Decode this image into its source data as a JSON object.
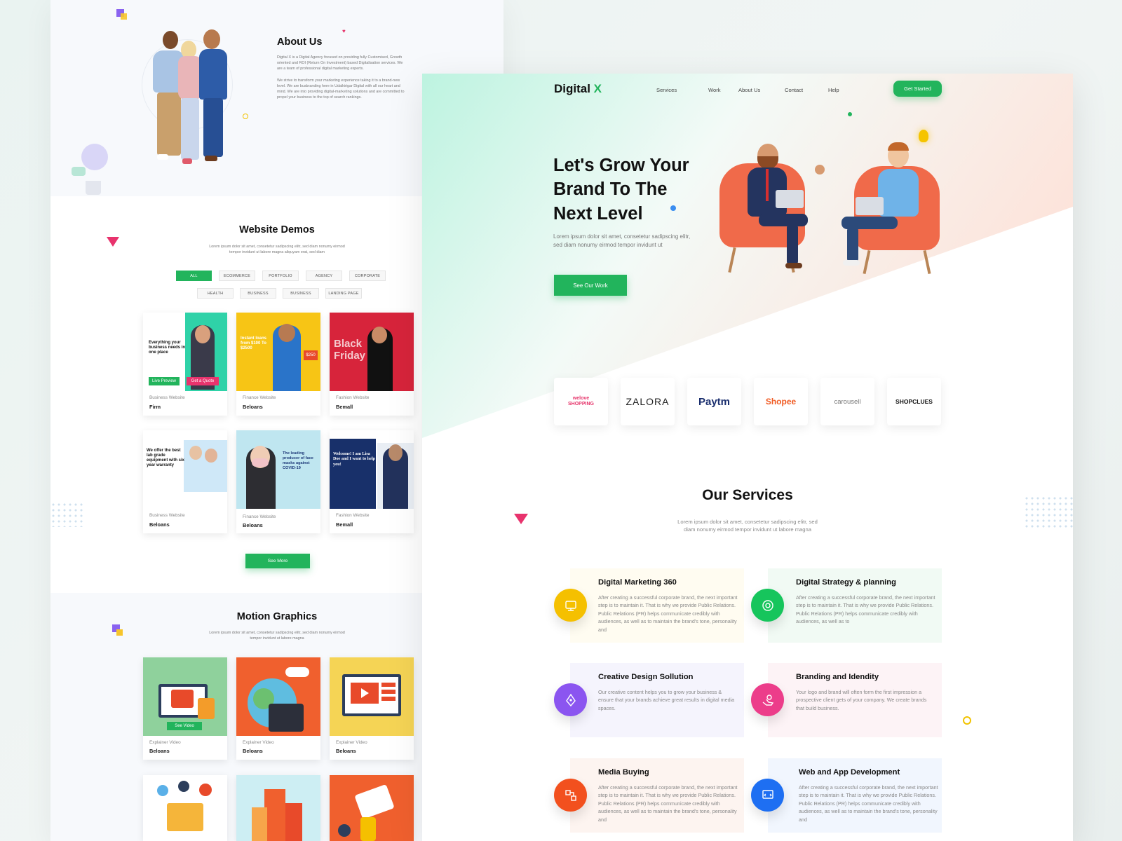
{
  "left": {
    "about": {
      "title": "About Us",
      "para1": "Digital X is a Digital Agency focused on providing fully Customised, Growth oriented and ROI (Return On Investment) based Digitalisation services. We are a team of professional digital marketing experts.",
      "para2": "We strive to transform your marketing experience taking it to a brand-new level. We are busbranding here in Udaikirigar Digital with all our heart and mind. We are into providing digital-marketing solutions and are committed to propel your business to the top of search rankings."
    },
    "demos": {
      "title": "Website Demos",
      "subtitle": "Lorem ipsum dolor sit amet, consetetur sadipscing elitr, sed diam nonumy eirmod tempor invidunt ut labore magna aliquyam erat, sed diam",
      "filters_row1": [
        "ALL",
        "ECOMMERCE",
        "PORTFOLIO",
        "AGENCY",
        "CORPORATE"
      ],
      "filters_row2": [
        "HEALTH",
        "BUSINESS",
        "BUSINESS",
        "LANDING PAGE"
      ],
      "cards": [
        {
          "category": "Business Website",
          "name": "Firm",
          "thumb_headline": "Everything your business needs in one place",
          "btn1": "Live Preview",
          "btn2": "Get a Quote"
        },
        {
          "category": "Finance Website",
          "name": "Beloans",
          "thumb_headline": "Instant loans from $100 To $2500",
          "price": "$250"
        },
        {
          "category": "Fashion Website",
          "name": "Bemall",
          "thumb_headline": "Black Friday"
        },
        {
          "category": "Business Website",
          "name": "Beloans",
          "thumb_headline": "We offer the best lab grade equipment with six year warranty"
        },
        {
          "category": "Finance Website",
          "name": "Beloans",
          "thumb_headline": "The leading producer of face masks against COVID-19"
        },
        {
          "category": "Fashion Website",
          "name": "Bemall",
          "thumb_headline": "Welcome! I am Lisa Doe and I want to help you!"
        }
      ],
      "see_more": "See More"
    },
    "motion": {
      "title": "Motion Graphics",
      "subtitle": "Lorem ipsum dolor sit amet, consetetur sadipscing elitr, sed diam nonumy eirmod tempor invidunt ut labore magna",
      "cards": [
        {
          "category": "Explainer Video",
          "name": "Beloans",
          "btn": "See Video"
        },
        {
          "category": "Explainer Video",
          "name": "Beloans"
        },
        {
          "category": "Explainer Video",
          "name": "Beloans"
        }
      ]
    }
  },
  "right": {
    "brand": {
      "name": "Digital ",
      "accent": "X"
    },
    "nav": [
      "Services",
      "Work",
      "About Us",
      "Contact",
      "Help"
    ],
    "cta": "Get Started",
    "hero": {
      "line1": "Let's Grow Your",
      "line2": "Brand To The",
      "line3": "Next Level",
      "desc": "Lorem ipsum dolor sit amet, consetetur sadipscing elitr, sed diam nonumy eirmod tempor invidunt ut",
      "button": "See Our Work"
    },
    "clients": [
      "welove SHOPPING",
      "ZALORA",
      "Paytm",
      "Shopee",
      "carousell",
      "SHOPCLUES"
    ],
    "services_section": {
      "title": "Our Services",
      "subtitle": "Lorem ipsum dolor sit amet, consetetur sadipscing elitr, sed diam nonumy eirmod tempor invidunt ut labore magna"
    },
    "services": [
      {
        "title": "Digital Marketing 360",
        "desc": "After creating a successful corporate brand, the next important step is to maintain it. That is why we provide Public Relations. Public Relations (PR) helps communicate credibly with audiences, as well as to maintain the brand's tone, personality and"
      },
      {
        "title": "Digital Strategy & planning",
        "desc": "After creating a successful corporate brand, the next important step is to maintain it. That is why we provide Public Relations. Public Relations (PR) helps communicate credibly with audiences, as well as to"
      },
      {
        "title": "Creative Design Sollution",
        "desc": "Our creative content helps you to grow your business & ensure that your brands achieve great results in digital media spaces."
      },
      {
        "title": "Branding and Idendity",
        "desc": "Your logo and brand will often form the first impression a prospective client gets of your company. We create brands that build business."
      },
      {
        "title": "Media Buying",
        "desc": "After creating a successful corporate brand, the next important step is to maintain it. That is why we provide Public Relations. Public Relations (PR) helps communicate credibly with audiences, as well as to maintain the brand's tone, personality and"
      },
      {
        "title": "Web and App Development",
        "desc": "After creating a successful corporate brand, the next important step is to maintain it. That is why we provide Public Relations. Public Relations (PR) helps communicate credibly with audiences, as well as to maintain the brand's tone, personality and"
      }
    ],
    "colors": {
      "accent": "#22b45c",
      "svc1": "#f5c000",
      "svc2": "#16c55c",
      "svc3": "#8b55f0",
      "svc4": "#ec3d8a",
      "svc5": "#f2501e",
      "svc6": "#1e6ff2"
    }
  }
}
